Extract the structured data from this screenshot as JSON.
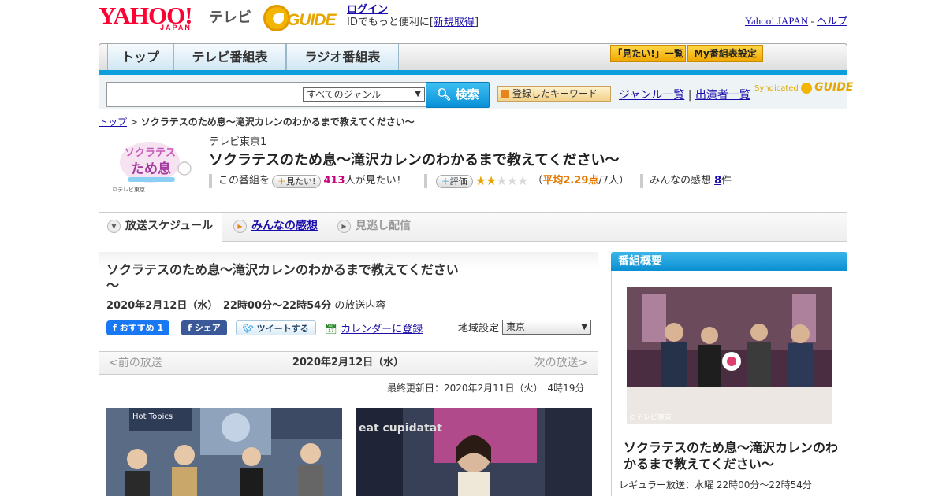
{
  "header": {
    "brand_main": "YAHOO!",
    "brand_sub": "JAPAN",
    "brand_service": "テレビ",
    "gguide_logo": "GUIDE",
    "login_label": "ログイン",
    "login_prompt_prefix": "IDでもっと便利に[",
    "register_label": "新規取得",
    "login_prompt_suffix": "]",
    "yahoo_japan_link": "Yahoo! JAPAN",
    "util_sep": "-",
    "help_link": "ヘルプ"
  },
  "nav": {
    "tabs": [
      {
        "label": "トップ"
      },
      {
        "label": "テレビ番組表"
      },
      {
        "label": "ラジオ番組表"
      }
    ],
    "mitai_list_label": "「見たい!」一覧",
    "my_bangumi_label": "My番組表設定"
  },
  "search": {
    "query": "",
    "genre_selected": "すべてのジャンル",
    "search_button_label": "検索",
    "keyword_button_label": "登録したキーワード",
    "genre_list_link": "ジャンル一覧",
    "link_sep": "|",
    "performer_list_link": "出演者一覧",
    "syndicated_label": "Syndicated"
  },
  "breadcrumb": {
    "top_label": "トップ",
    "sep": ">",
    "current": "ソクラテスのため息～滝沢カレンのわかるまで教えてください～"
  },
  "program": {
    "station": "テレビ東京1",
    "title": "ソクラテスのため息～滝沢カレンのわかるまで教えてください～",
    "mitai_prefix": "この番組を",
    "mitai_pill": "見たい!",
    "mitai_count": "413",
    "mitai_suffix": "人が見たい！",
    "rating_pill": "評価",
    "rating_stars": 2,
    "rating_max": 5,
    "rating_paren_open": "（",
    "rating_avg": "平均2.29点",
    "rating_voters": "/7人",
    "rating_paren_close": "）",
    "reviews_label": "みんなの感想",
    "reviews_count": "8",
    "reviews_unit": "件",
    "logo_copyright": "©テレビ東京"
  },
  "subtabs": [
    {
      "label": "放送スケジュール",
      "active": true
    },
    {
      "label": "みんなの感想",
      "link": true
    },
    {
      "label": "見逃し配信",
      "disabled": true
    }
  ],
  "episode": {
    "title": "ソクラテスのため息～滝沢カレンのわかるまで教えてください～",
    "datetime": "2020年2月12日（水）　22時00分～22時54分",
    "datetime_suffix": "の放送内容",
    "fb_recommend_label": "おすすめ",
    "fb_recommend_count": "1",
    "fb_share_label": "シェア",
    "tweet_label": "ツイートする",
    "calendar_label": "カレンダーに登録",
    "region_label": "地域設定",
    "region_selected": "東京",
    "prev_label": "<前の放送",
    "current_date": "2020年2月12日（水）",
    "next_label": "次の放送>",
    "last_updated": "最終更新日：2020年2月11日（火）　4時19分"
  },
  "sidebar": {
    "header": "番組概要",
    "image_copyright": "©テレビ東京",
    "title": "ソクラテスのため息～滝沢カレンのわかるまで教えてください～",
    "regular_broadcast": "レギュラー放送：水曜 22時00分～22時54分"
  },
  "colors": {
    "accent_blue": "#0c9fdc",
    "brand_red": "#ff0033",
    "gguide_yellow": "#f3b500",
    "mitai_count": "#c6007e",
    "rating_orange": "#e47900"
  }
}
